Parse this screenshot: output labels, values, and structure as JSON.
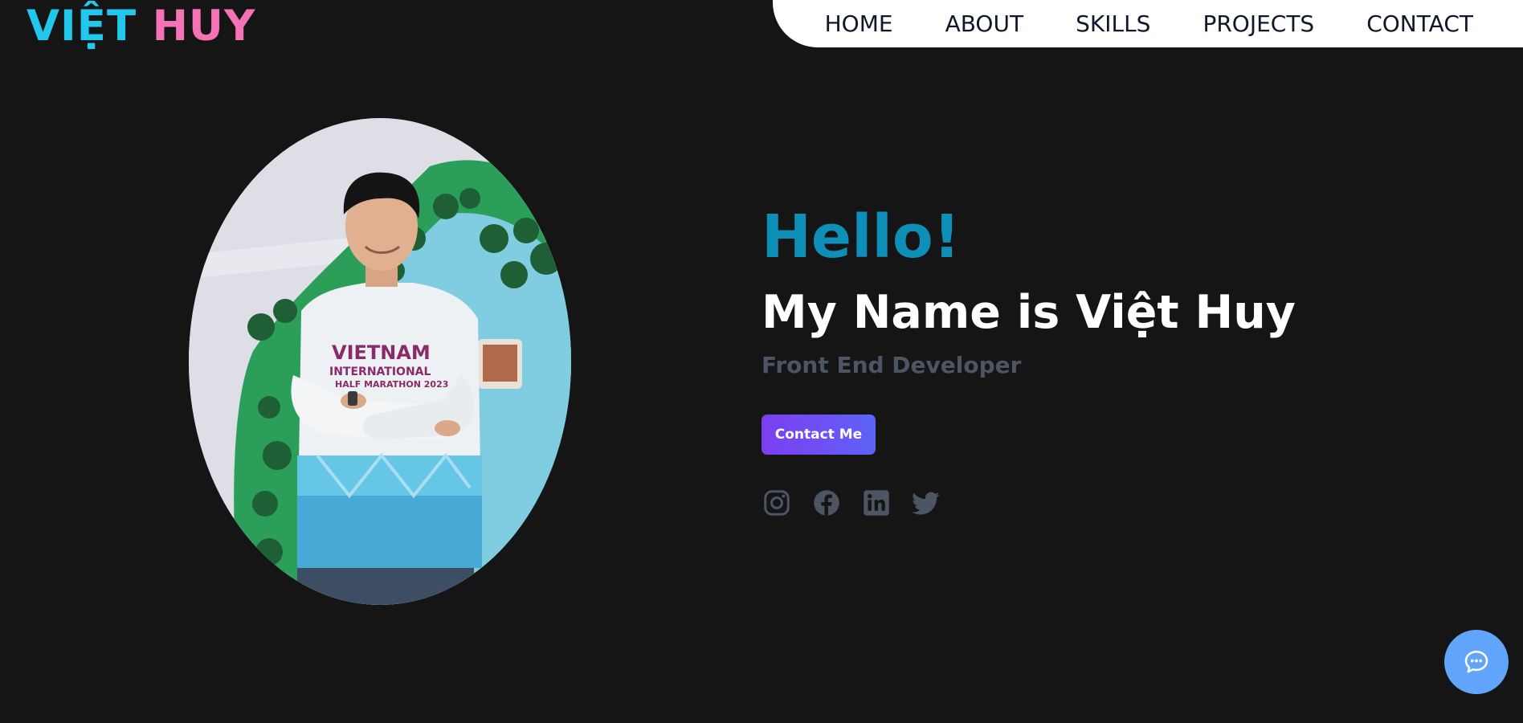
{
  "logo": {
    "first": "VIỆT",
    "second": "HUY",
    "first_color": "#22c7ec",
    "second_color": "#f472b6"
  },
  "nav": {
    "items": [
      {
        "label": "HOME"
      },
      {
        "label": "ABOUT"
      },
      {
        "label": "SKILLS"
      },
      {
        "label": "PROJECTS"
      },
      {
        "label": "CONTACT"
      }
    ]
  },
  "hero": {
    "greeting": "Hello!",
    "name": "My Name is Việt Huy",
    "role": "Front End Developer",
    "cta_label": "Contact Me",
    "photo_shirt_text": [
      "VIETNAM",
      "INTERNATIONAL",
      "HALF MARATHON 2023"
    ]
  },
  "socials": [
    {
      "icon": "instagram-icon"
    },
    {
      "icon": "facebook-icon"
    },
    {
      "icon": "linkedin-icon"
    },
    {
      "icon": "twitter-icon"
    }
  ],
  "chat": {
    "icon": "chat-icon"
  },
  "colors": {
    "background": "#151516",
    "greeting": "#0e8fb7",
    "role": "#4b5563",
    "social_icon": "#4b5563",
    "button_gradient_start": "#7a3ff0",
    "button_gradient_end": "#5b65f7",
    "chat_button": "#60a5fa"
  }
}
